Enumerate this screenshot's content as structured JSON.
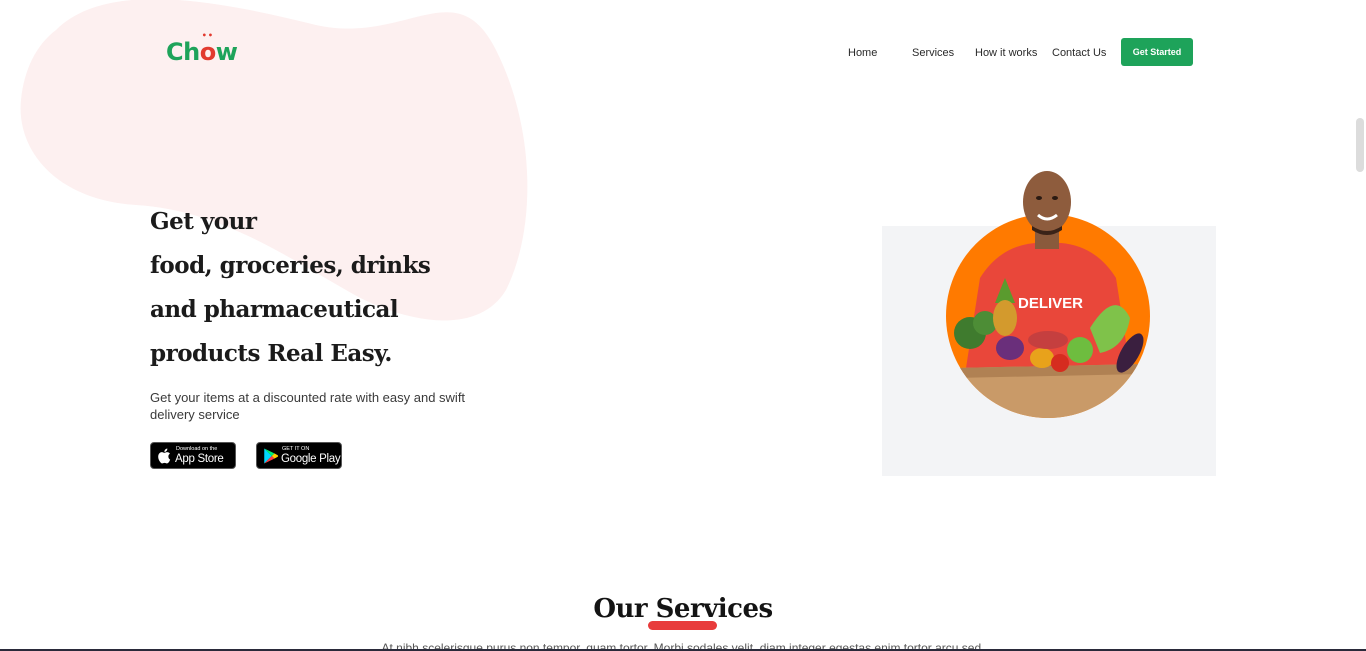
{
  "brand": {
    "logo_prefix": "Ch",
    "logo_o": "o",
    "logo_suffix": "w",
    "logo_dots": "••",
    "green": "#1ea35a",
    "red": "#e23a2f"
  },
  "nav": {
    "items": [
      {
        "label": "Home"
      },
      {
        "label": "Services"
      },
      {
        "label": "How it works"
      },
      {
        "label": "Contact Us"
      }
    ],
    "cta_label": "Get Started"
  },
  "hero": {
    "title_lines": [
      "Get your",
      "food, groceries, drinks",
      "and pharmaceutical",
      "products Real Easy."
    ],
    "subtitle": "Get your items at a discounted rate with easy and swift delivery service",
    "app_store": {
      "small": "Download on the",
      "big": "App Store",
      "icon": "apple-icon"
    },
    "google_play": {
      "small": "GET IT ON",
      "big": "Google Play",
      "icon": "google-play-icon"
    },
    "image_text": "DELIVER"
  },
  "services": {
    "title": "Our Services",
    "description": "At nibh scelerisque purus non tempor, quam tortor. Morbi sodales velit, diam integer egestas enim tortor arcu sed."
  },
  "colors": {
    "accent_orange": "#ff7a00",
    "underline_red": "#e83b3b",
    "blob_pink": "#fdf0f0"
  }
}
